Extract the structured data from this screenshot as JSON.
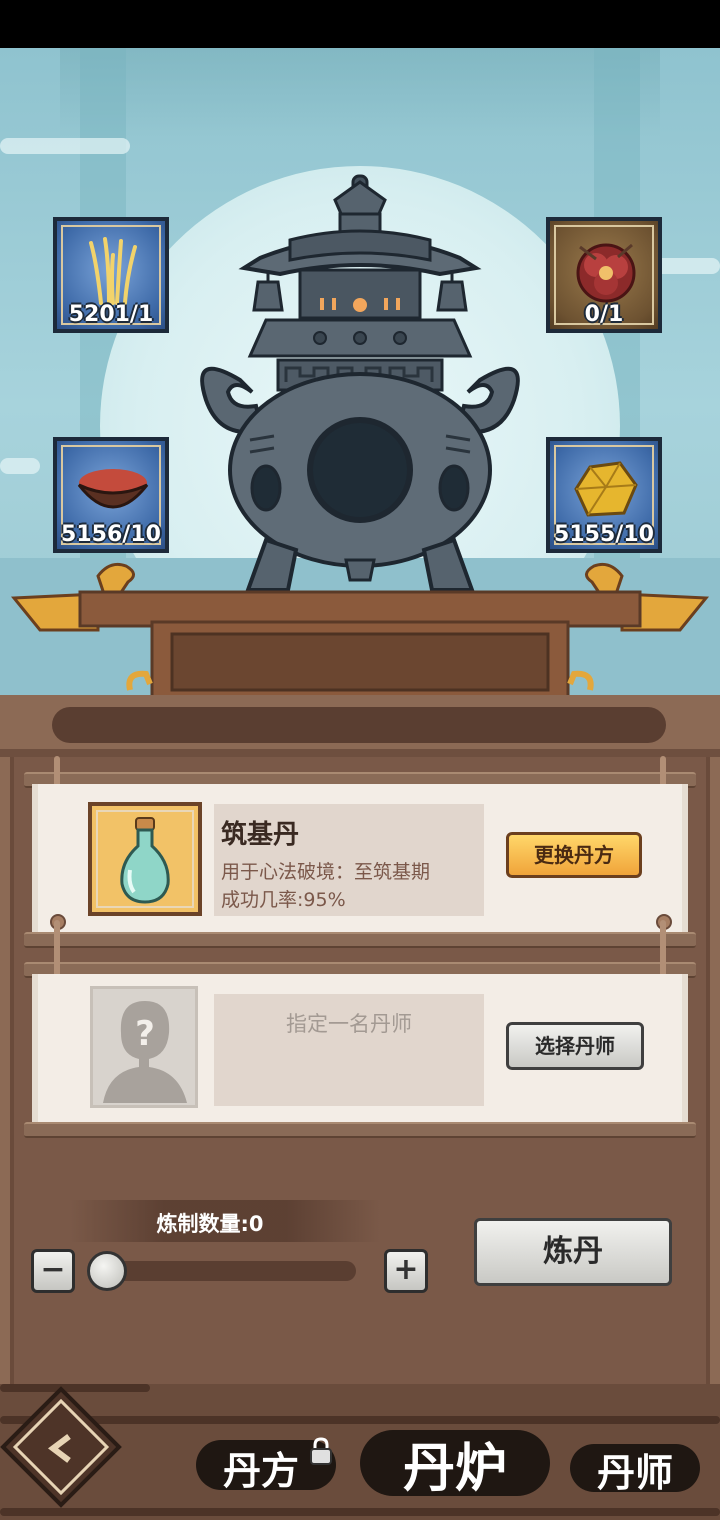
{
  "ingredients": [
    {
      "name": "golden-grass",
      "count": "5201/1"
    },
    {
      "name": "red-flower",
      "count": "0/1"
    },
    {
      "name": "red-powder",
      "count": "5156/10"
    },
    {
      "name": "yellow-crystal",
      "count": "5155/10"
    }
  ],
  "recipe": {
    "name": "筑基丹",
    "description": "用于心法破境：至筑基期",
    "success_rate": "成功几率:95%",
    "change_button": "更换丹方"
  },
  "master": {
    "hint": "指定一名丹师",
    "select_button": "选择丹师"
  },
  "refine": {
    "quantity_label": "炼制数量:0",
    "quantity": 0,
    "minus": "−",
    "plus": "+",
    "button": "炼丹"
  },
  "nav": {
    "tabs": [
      {
        "label": "丹方",
        "locked": true
      },
      {
        "label": "丹炉",
        "active": true
      },
      {
        "label": "丹师"
      }
    ]
  },
  "colors": {
    "sky": "#a7d3dc",
    "wood": "#8c6a55",
    "gold_button": "#f0a43a",
    "scroll": "#f3ede6"
  }
}
